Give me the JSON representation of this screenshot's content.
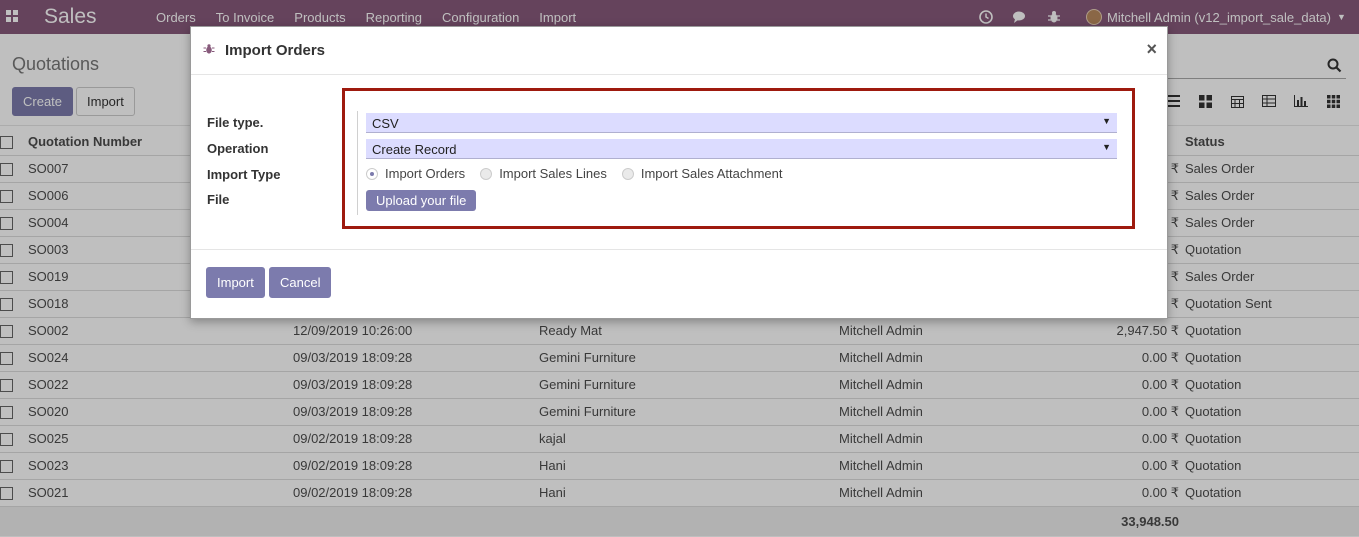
{
  "navbar": {
    "brand": "Sales",
    "menu": [
      "Orders",
      "To Invoice",
      "Products",
      "Reporting",
      "Configuration",
      "Import"
    ],
    "user": "Mitchell Admin (v12_import_sale_data)"
  },
  "control_panel": {
    "title": "Quotations",
    "create_label": "Create",
    "import_label": "Import"
  },
  "table": {
    "headers": {
      "number": "Quotation Number",
      "status": "Status"
    },
    "rows": [
      {
        "number": "SO007",
        "date": "",
        "customer": "",
        "salesperson": "",
        "total": "₹",
        "status": "Sales Order"
      },
      {
        "number": "SO006",
        "date": "",
        "customer": "",
        "salesperson": "",
        "total": "₹",
        "status": "Sales Order"
      },
      {
        "number": "SO004",
        "date": "",
        "customer": "",
        "salesperson": "",
        "total": "₹",
        "status": "Sales Order"
      },
      {
        "number": "SO003",
        "date": "",
        "customer": "",
        "salesperson": "",
        "total": "₹",
        "status": "Quotation"
      },
      {
        "number": "SO019",
        "date": "",
        "customer": "",
        "salesperson": "",
        "total": "₹",
        "status": "Sales Order"
      },
      {
        "number": "SO018",
        "date": "",
        "customer": "",
        "salesperson": "",
        "total": "₹",
        "status": "Quotation Sent"
      },
      {
        "number": "SO002",
        "date": "12/09/2019 10:26:00",
        "customer": "Ready Mat",
        "salesperson": "Mitchell Admin",
        "total": "2,947.50 ₹",
        "status": "Quotation"
      },
      {
        "number": "SO024",
        "date": "09/03/2019 18:09:28",
        "customer": "Gemini Furniture",
        "salesperson": "Mitchell Admin",
        "total": "0.00 ₹",
        "status": "Quotation"
      },
      {
        "number": "SO022",
        "date": "09/03/2019 18:09:28",
        "customer": "Gemini Furniture",
        "salesperson": "Mitchell Admin",
        "total": "0.00 ₹",
        "status": "Quotation"
      },
      {
        "number": "SO020",
        "date": "09/03/2019 18:09:28",
        "customer": "Gemini Furniture",
        "salesperson": "Mitchell Admin",
        "total": "0.00 ₹",
        "status": "Quotation"
      },
      {
        "number": "SO025",
        "date": "09/02/2019 18:09:28",
        "customer": "kajal",
        "salesperson": "Mitchell Admin",
        "total": "0.00 ₹",
        "status": "Quotation"
      },
      {
        "number": "SO023",
        "date": "09/02/2019 18:09:28",
        "customer": "Hani",
        "salesperson": "Mitchell Admin",
        "total": "0.00 ₹",
        "status": "Quotation"
      },
      {
        "number": "SO021",
        "date": "09/02/2019 18:09:28",
        "customer": "Hani",
        "salesperson": "Mitchell Admin",
        "total": "0.00 ₹",
        "status": "Quotation"
      }
    ],
    "footer_total": "33,948.50"
  },
  "modal": {
    "title": "Import Orders",
    "fields": {
      "file_type_label": "File type.",
      "file_type_value": "CSV",
      "operation_label": "Operation",
      "operation_value": "Create Record",
      "import_type_label": "Import Type",
      "file_label": "File"
    },
    "import_type_options": [
      "Import Orders",
      "Import Sales Lines",
      "Import Sales Attachment"
    ],
    "selected_import_type": "Import Orders",
    "upload_label": "Upload your file",
    "import_button": "Import",
    "cancel_button": "Cancel"
  },
  "colors": {
    "navbar": "#875a7b",
    "primary": "#7c7bad",
    "highlight": "#9e1a0e",
    "select_bg": "#dcdcff"
  }
}
